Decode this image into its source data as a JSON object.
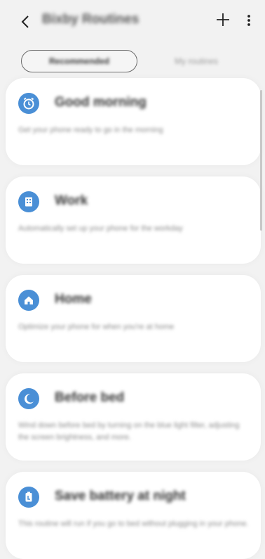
{
  "header": {
    "title": "Bixby Routines",
    "icons": {
      "back": "back-arrow-icon",
      "add": "plus-icon",
      "menu": "more-vertical-icon"
    }
  },
  "tabs": [
    {
      "label": "Recommended",
      "active": true
    },
    {
      "label": "My routines",
      "active": false
    }
  ],
  "routines": [
    {
      "name": "Good morning",
      "description": "Get your phone ready to go in the morning",
      "icon": "alarm-clock-icon"
    },
    {
      "name": "Work",
      "description": "Automatically set up your phone for the workday",
      "icon": "building-icon"
    },
    {
      "name": "Home",
      "description": "Optimize your phone for when you're at home",
      "icon": "house-icon"
    },
    {
      "name": "Before bed",
      "description": "Wind down before bed by turning on the blue light filter, adjusting the screen brightness, and more.",
      "icon": "moon-icon"
    },
    {
      "name": "Save battery at night",
      "description": "This routine will run if you go to bed without plugging in your phone.",
      "icon": "battery-icon"
    }
  ],
  "colors": {
    "accent": "#4a8fd6",
    "background": "#f2f2f2",
    "card": "#ffffff"
  }
}
